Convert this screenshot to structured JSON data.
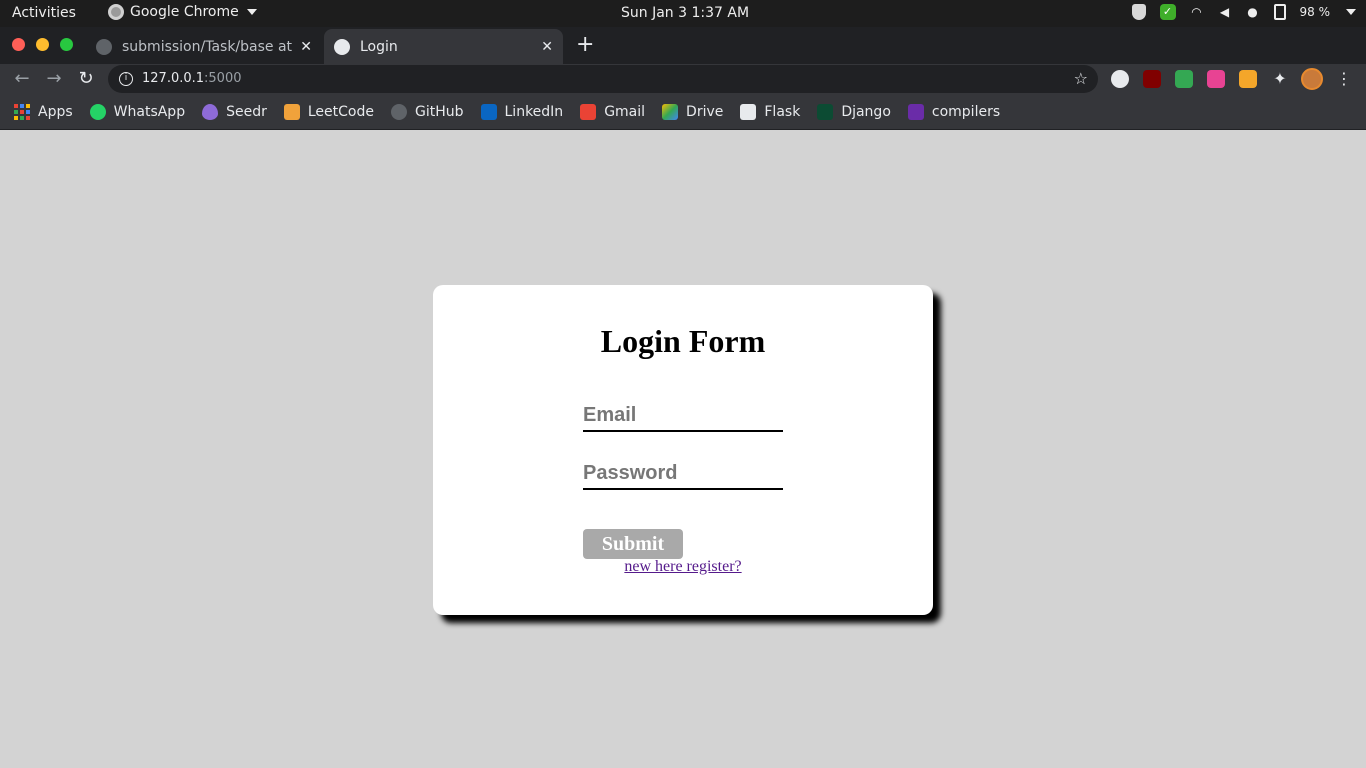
{
  "system_bar": {
    "activities": "Activities",
    "app_name": "Google Chrome",
    "clock": "Sun Jan 3   1:37 AM",
    "battery": "98 %"
  },
  "browser": {
    "tabs": [
      {
        "title": "submission/Task/base at",
        "active": false,
        "icon": "github-icon"
      },
      {
        "title": "Login",
        "active": true,
        "icon": "globe-icon"
      }
    ],
    "url_host": "127.0.0.1",
    "url_port": ":5000",
    "bookmarks": [
      {
        "label": "Apps",
        "icon": "apps-grid-icon"
      },
      {
        "label": "WhatsApp",
        "icon": "whatsapp-icon"
      },
      {
        "label": "Seedr",
        "icon": "seedr-icon"
      },
      {
        "label": "LeetCode",
        "icon": "leetcode-icon"
      },
      {
        "label": "GitHub",
        "icon": "github-icon"
      },
      {
        "label": "LinkedIn",
        "icon": "linkedin-icon"
      },
      {
        "label": "Gmail",
        "icon": "gmail-icon"
      },
      {
        "label": "Drive",
        "icon": "drive-icon"
      },
      {
        "label": "Flask",
        "icon": "flask-icon"
      },
      {
        "label": "Django",
        "icon": "django-icon"
      },
      {
        "label": "compilers",
        "icon": "compilers-icon"
      }
    ]
  },
  "form": {
    "title": "Login Form",
    "email_placeholder": "Email",
    "password_placeholder": "Password",
    "submit_label": "Submit",
    "register_link": "new here register?"
  },
  "colors": {
    "page_background": "#d3d3d3",
    "card_background": "#ffffff",
    "submit_background": "#a9a9a9",
    "link_visited": "#551a8b"
  }
}
